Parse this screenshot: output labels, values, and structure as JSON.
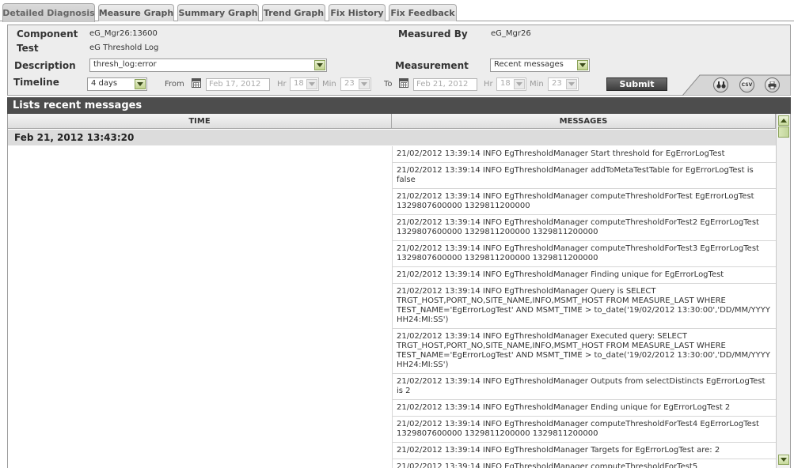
{
  "tabs": [
    "Detailed Diagnosis",
    "Measure Graph",
    "Summary Graph",
    "Trend Graph",
    "Fix History",
    "Fix Feedback"
  ],
  "form": {
    "component_label": "Component",
    "component_value": "eG_Mgr26:13600",
    "test_label": "Test",
    "test_value": "eG Threshold Log",
    "measured_by_label": "Measured By",
    "measured_by_value": "eG_Mgr26",
    "description_label": "Description",
    "description_value": "thresh_log:error",
    "measurement_label": "Measurement",
    "measurement_value": "Recent messages",
    "timeline_label": "Timeline",
    "timeline_value": "4 days",
    "from_label": "From",
    "from_date": "Feb 17, 2012",
    "to_label": "To",
    "to_date": "Feb 21, 2012",
    "hr_label": "Hr",
    "min_label": "Min",
    "from_hr": "18",
    "from_min": "23",
    "to_hr": "18",
    "to_min": "23",
    "submit_label": "Submit"
  },
  "toolbar": {
    "binoculars": "binoculars-icon",
    "csv": "CSV",
    "print": "print-icon"
  },
  "results": {
    "title": "Lists recent messages",
    "col_time": "TIME",
    "col_messages": "MESSAGES",
    "group_time": "Feb 21, 2012 13:43:20",
    "messages": [
      "21/02/2012 13:39:14 INFO EgThresholdManager Start threshold for EgErrorLogTest",
      "21/02/2012 13:39:14 INFO EgThresholdManager addToMetaTestTable for EgErrorLogTest is false",
      "21/02/2012 13:39:14 INFO EgThresholdManager computeThresholdForTest EgErrorLogTest 1329807600000 1329811200000",
      "21/02/2012 13:39:14 INFO EgThresholdManager computeThresholdForTest2 EgErrorLogTest 1329807600000 1329811200000 1329811200000",
      "21/02/2012 13:39:14 INFO EgThresholdManager computeThresholdForTest3 EgErrorLogTest 1329807600000 1329811200000 1329811200000",
      "21/02/2012 13:39:14 INFO EgThresholdManager Finding unique for EgErrorLogTest",
      "21/02/2012 13:39:14 INFO EgThresholdManager Query is SELECT TRGT_HOST,PORT_NO,SITE_NAME,INFO,MSMT_HOST FROM MEASURE_LAST WHERE TEST_NAME='EgErrorLogTest' AND MSMT_TIME > to_date('19/02/2012 13:30:00','DD/MM/YYYY HH24:MI:SS')",
      "21/02/2012 13:39:14 INFO EgThresholdManager Executed query: SELECT TRGT_HOST,PORT_NO,SITE_NAME,INFO,MSMT_HOST FROM MEASURE_LAST WHERE TEST_NAME='EgErrorLogTest' AND MSMT_TIME > to_date('19/02/2012 13:30:00','DD/MM/YYYY HH24:MI:SS')",
      "21/02/2012 13:39:14 INFO EgThresholdManager Outputs from selectDistincts EgErrorLogTest is 2",
      "21/02/2012 13:39:14 INFO EgThresholdManager Ending unique for EgErrorLogTest 2",
      "21/02/2012 13:39:14 INFO EgThresholdManager computeThresholdForTest4 EgErrorLogTest 1329807600000 1329811200000 1329811200000",
      "21/02/2012 13:39:14 INFO EgThresholdManager Targets for EgErrorLogTest are: 2",
      "21/02/2012 13:39:14 INFO EgThresholdManager computeThresholdForTest5"
    ]
  }
}
